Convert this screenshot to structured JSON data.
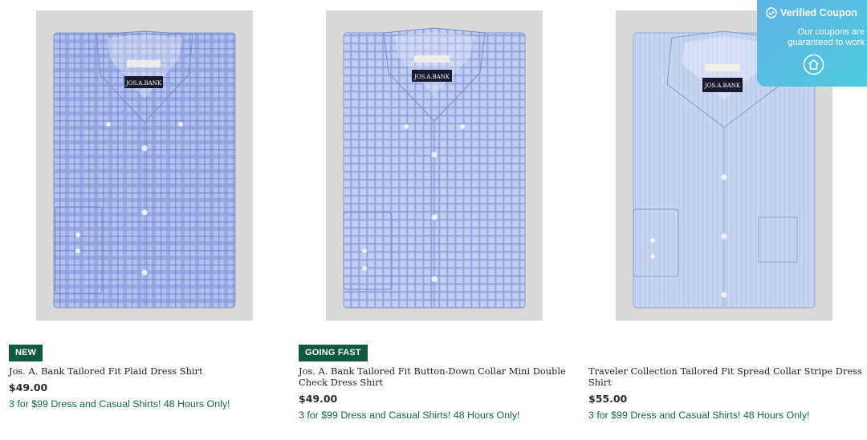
{
  "products": [
    {
      "badge": "NEW",
      "title": "Jos. A. Bank Tailored Fit Plaid Dress Shirt",
      "price": "$49.00",
      "promo": "3 for $99 Dress and Casual Shirts! 48 Hours Only!",
      "label": "JOS.A.BANK",
      "colors": {
        "base": "#a8b8ec",
        "line": "#7d8fd6"
      }
    },
    {
      "badge": "GOING FAST",
      "title": "Jos. A. Bank Tailored Fit Button-Down Collar Mini Double Check Dress Shirt",
      "price": "$49.00",
      "promo": "3 for $99 Dress and Casual Shirts! 48 Hours Only!",
      "label": "JOS.A.BANK",
      "colors": {
        "base": "#b9c5ef",
        "line": "#8c9ce0"
      }
    },
    {
      "badge": "",
      "title": "Traveler Collection Tailored Fit Spread Collar Stripe Dress Shirt",
      "price": "$55.00",
      "promo": "3 for $99 Dress and Casual Shirts! 48 Hours Only!",
      "label": "JOS.A.BANK",
      "colors": {
        "base": "#c2d2f0",
        "line": "#a8bbe6"
      }
    }
  ],
  "coupon": {
    "title": "Verified Coupon",
    "subtitle": "Our coupons are guaranteed to work",
    "icon": "home-icon"
  },
  "colors": {
    "badge_bg": "#0f5a3f",
    "promo_text": "#0f6b43",
    "image_bg": "#d9d9d9"
  }
}
